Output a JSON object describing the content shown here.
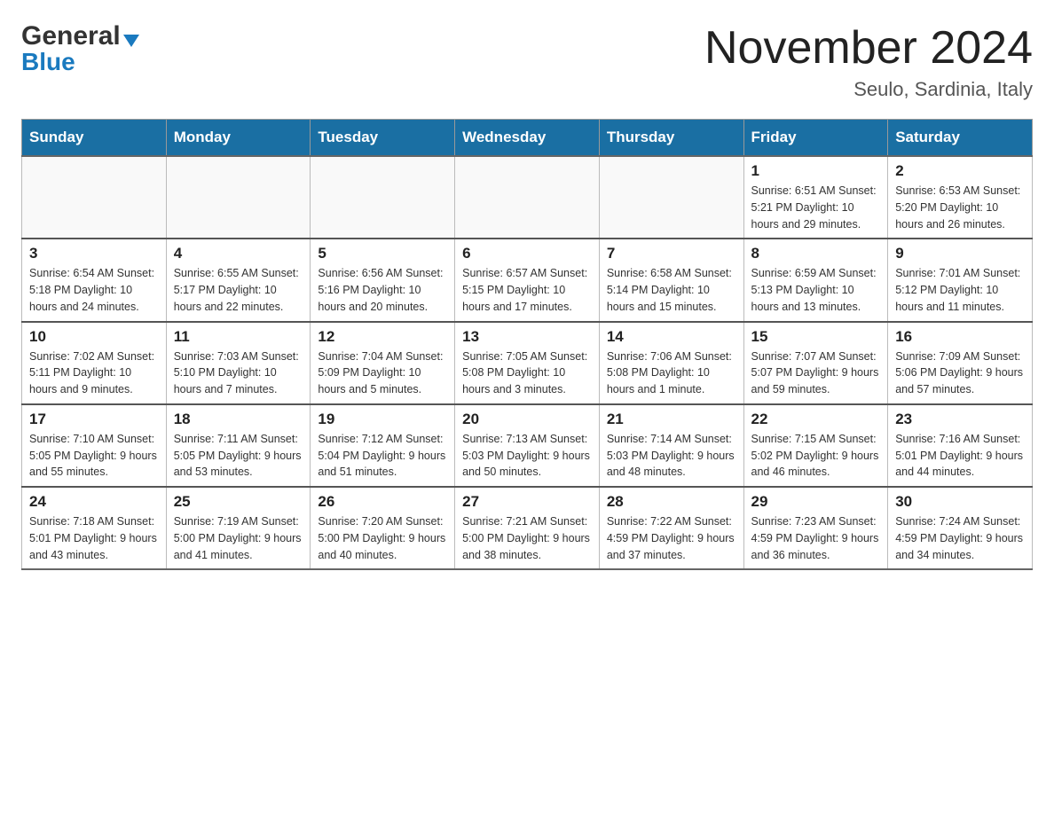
{
  "logo": {
    "general": "General",
    "blue": "Blue"
  },
  "title": "November 2024",
  "subtitle": "Seulo, Sardinia, Italy",
  "days_of_week": [
    "Sunday",
    "Monday",
    "Tuesday",
    "Wednesday",
    "Thursday",
    "Friday",
    "Saturday"
  ],
  "weeks": [
    [
      {
        "day": "",
        "info": ""
      },
      {
        "day": "",
        "info": ""
      },
      {
        "day": "",
        "info": ""
      },
      {
        "day": "",
        "info": ""
      },
      {
        "day": "",
        "info": ""
      },
      {
        "day": "1",
        "info": "Sunrise: 6:51 AM\nSunset: 5:21 PM\nDaylight: 10 hours\nand 29 minutes."
      },
      {
        "day": "2",
        "info": "Sunrise: 6:53 AM\nSunset: 5:20 PM\nDaylight: 10 hours\nand 26 minutes."
      }
    ],
    [
      {
        "day": "3",
        "info": "Sunrise: 6:54 AM\nSunset: 5:18 PM\nDaylight: 10 hours\nand 24 minutes."
      },
      {
        "day": "4",
        "info": "Sunrise: 6:55 AM\nSunset: 5:17 PM\nDaylight: 10 hours\nand 22 minutes."
      },
      {
        "day": "5",
        "info": "Sunrise: 6:56 AM\nSunset: 5:16 PM\nDaylight: 10 hours\nand 20 minutes."
      },
      {
        "day": "6",
        "info": "Sunrise: 6:57 AM\nSunset: 5:15 PM\nDaylight: 10 hours\nand 17 minutes."
      },
      {
        "day": "7",
        "info": "Sunrise: 6:58 AM\nSunset: 5:14 PM\nDaylight: 10 hours\nand 15 minutes."
      },
      {
        "day": "8",
        "info": "Sunrise: 6:59 AM\nSunset: 5:13 PM\nDaylight: 10 hours\nand 13 minutes."
      },
      {
        "day": "9",
        "info": "Sunrise: 7:01 AM\nSunset: 5:12 PM\nDaylight: 10 hours\nand 11 minutes."
      }
    ],
    [
      {
        "day": "10",
        "info": "Sunrise: 7:02 AM\nSunset: 5:11 PM\nDaylight: 10 hours\nand 9 minutes."
      },
      {
        "day": "11",
        "info": "Sunrise: 7:03 AM\nSunset: 5:10 PM\nDaylight: 10 hours\nand 7 minutes."
      },
      {
        "day": "12",
        "info": "Sunrise: 7:04 AM\nSunset: 5:09 PM\nDaylight: 10 hours\nand 5 minutes."
      },
      {
        "day": "13",
        "info": "Sunrise: 7:05 AM\nSunset: 5:08 PM\nDaylight: 10 hours\nand 3 minutes."
      },
      {
        "day": "14",
        "info": "Sunrise: 7:06 AM\nSunset: 5:08 PM\nDaylight: 10 hours\nand 1 minute."
      },
      {
        "day": "15",
        "info": "Sunrise: 7:07 AM\nSunset: 5:07 PM\nDaylight: 9 hours\nand 59 minutes."
      },
      {
        "day": "16",
        "info": "Sunrise: 7:09 AM\nSunset: 5:06 PM\nDaylight: 9 hours\nand 57 minutes."
      }
    ],
    [
      {
        "day": "17",
        "info": "Sunrise: 7:10 AM\nSunset: 5:05 PM\nDaylight: 9 hours\nand 55 minutes."
      },
      {
        "day": "18",
        "info": "Sunrise: 7:11 AM\nSunset: 5:05 PM\nDaylight: 9 hours\nand 53 minutes."
      },
      {
        "day": "19",
        "info": "Sunrise: 7:12 AM\nSunset: 5:04 PM\nDaylight: 9 hours\nand 51 minutes."
      },
      {
        "day": "20",
        "info": "Sunrise: 7:13 AM\nSunset: 5:03 PM\nDaylight: 9 hours\nand 50 minutes."
      },
      {
        "day": "21",
        "info": "Sunrise: 7:14 AM\nSunset: 5:03 PM\nDaylight: 9 hours\nand 48 minutes."
      },
      {
        "day": "22",
        "info": "Sunrise: 7:15 AM\nSunset: 5:02 PM\nDaylight: 9 hours\nand 46 minutes."
      },
      {
        "day": "23",
        "info": "Sunrise: 7:16 AM\nSunset: 5:01 PM\nDaylight: 9 hours\nand 44 minutes."
      }
    ],
    [
      {
        "day": "24",
        "info": "Sunrise: 7:18 AM\nSunset: 5:01 PM\nDaylight: 9 hours\nand 43 minutes."
      },
      {
        "day": "25",
        "info": "Sunrise: 7:19 AM\nSunset: 5:00 PM\nDaylight: 9 hours\nand 41 minutes."
      },
      {
        "day": "26",
        "info": "Sunrise: 7:20 AM\nSunset: 5:00 PM\nDaylight: 9 hours\nand 40 minutes."
      },
      {
        "day": "27",
        "info": "Sunrise: 7:21 AM\nSunset: 5:00 PM\nDaylight: 9 hours\nand 38 minutes."
      },
      {
        "day": "28",
        "info": "Sunrise: 7:22 AM\nSunset: 4:59 PM\nDaylight: 9 hours\nand 37 minutes."
      },
      {
        "day": "29",
        "info": "Sunrise: 7:23 AM\nSunset: 4:59 PM\nDaylight: 9 hours\nand 36 minutes."
      },
      {
        "day": "30",
        "info": "Sunrise: 7:24 AM\nSunset: 4:59 PM\nDaylight: 9 hours\nand 34 minutes."
      }
    ]
  ]
}
